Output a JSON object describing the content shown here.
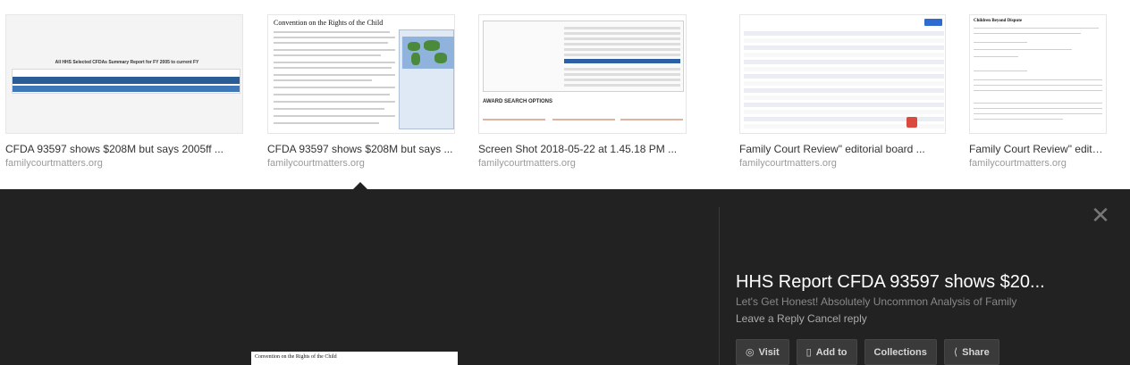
{
  "results": [
    {
      "title": "CFDA 93597 shows $208M but says 2005ff ...",
      "site": "familycourtmatters.org",
      "thumb_header": "All HHS Selected CFDAs Summary Report for FY 2005 to current FY"
    },
    {
      "title": "CFDA 93597 shows $208M but says ...",
      "site": "familycourtmatters.org",
      "thumb_header": "Convention on the Rights of the Child"
    },
    {
      "title": "Screen Shot 2018-05-22 at 1.45.18 PM ...",
      "site": "familycourtmatters.org",
      "thumb_header": "AWARD SEARCH OPTIONS"
    },
    {
      "title": "Family Court Review\" editorial board ...",
      "site": "familycourtmatters.org",
      "thumb_header": ""
    },
    {
      "title": "Family Court Review\" edito...",
      "site": "familycourtmatters.org",
      "thumb_header": "Children Beyond Dispute"
    }
  ],
  "panel": {
    "title": "HHS Report CFDA 93597 shows $20...",
    "subtitle": "Let's Get Honest! Absolutely Uncommon Analysis of Family",
    "reply_line": "Leave a Reply Cancel reply",
    "preview_header": "Convention on the Rights of the Child",
    "close_icon": "close-icon",
    "actions": {
      "visit": "Visit",
      "add_to": "Add to",
      "collections": "Collections",
      "share": "Share"
    }
  },
  "colors": {
    "panel_bg": "#222222",
    "button_bg": "#3a3a3a",
    "thumb_accent": "#2a5c95"
  }
}
